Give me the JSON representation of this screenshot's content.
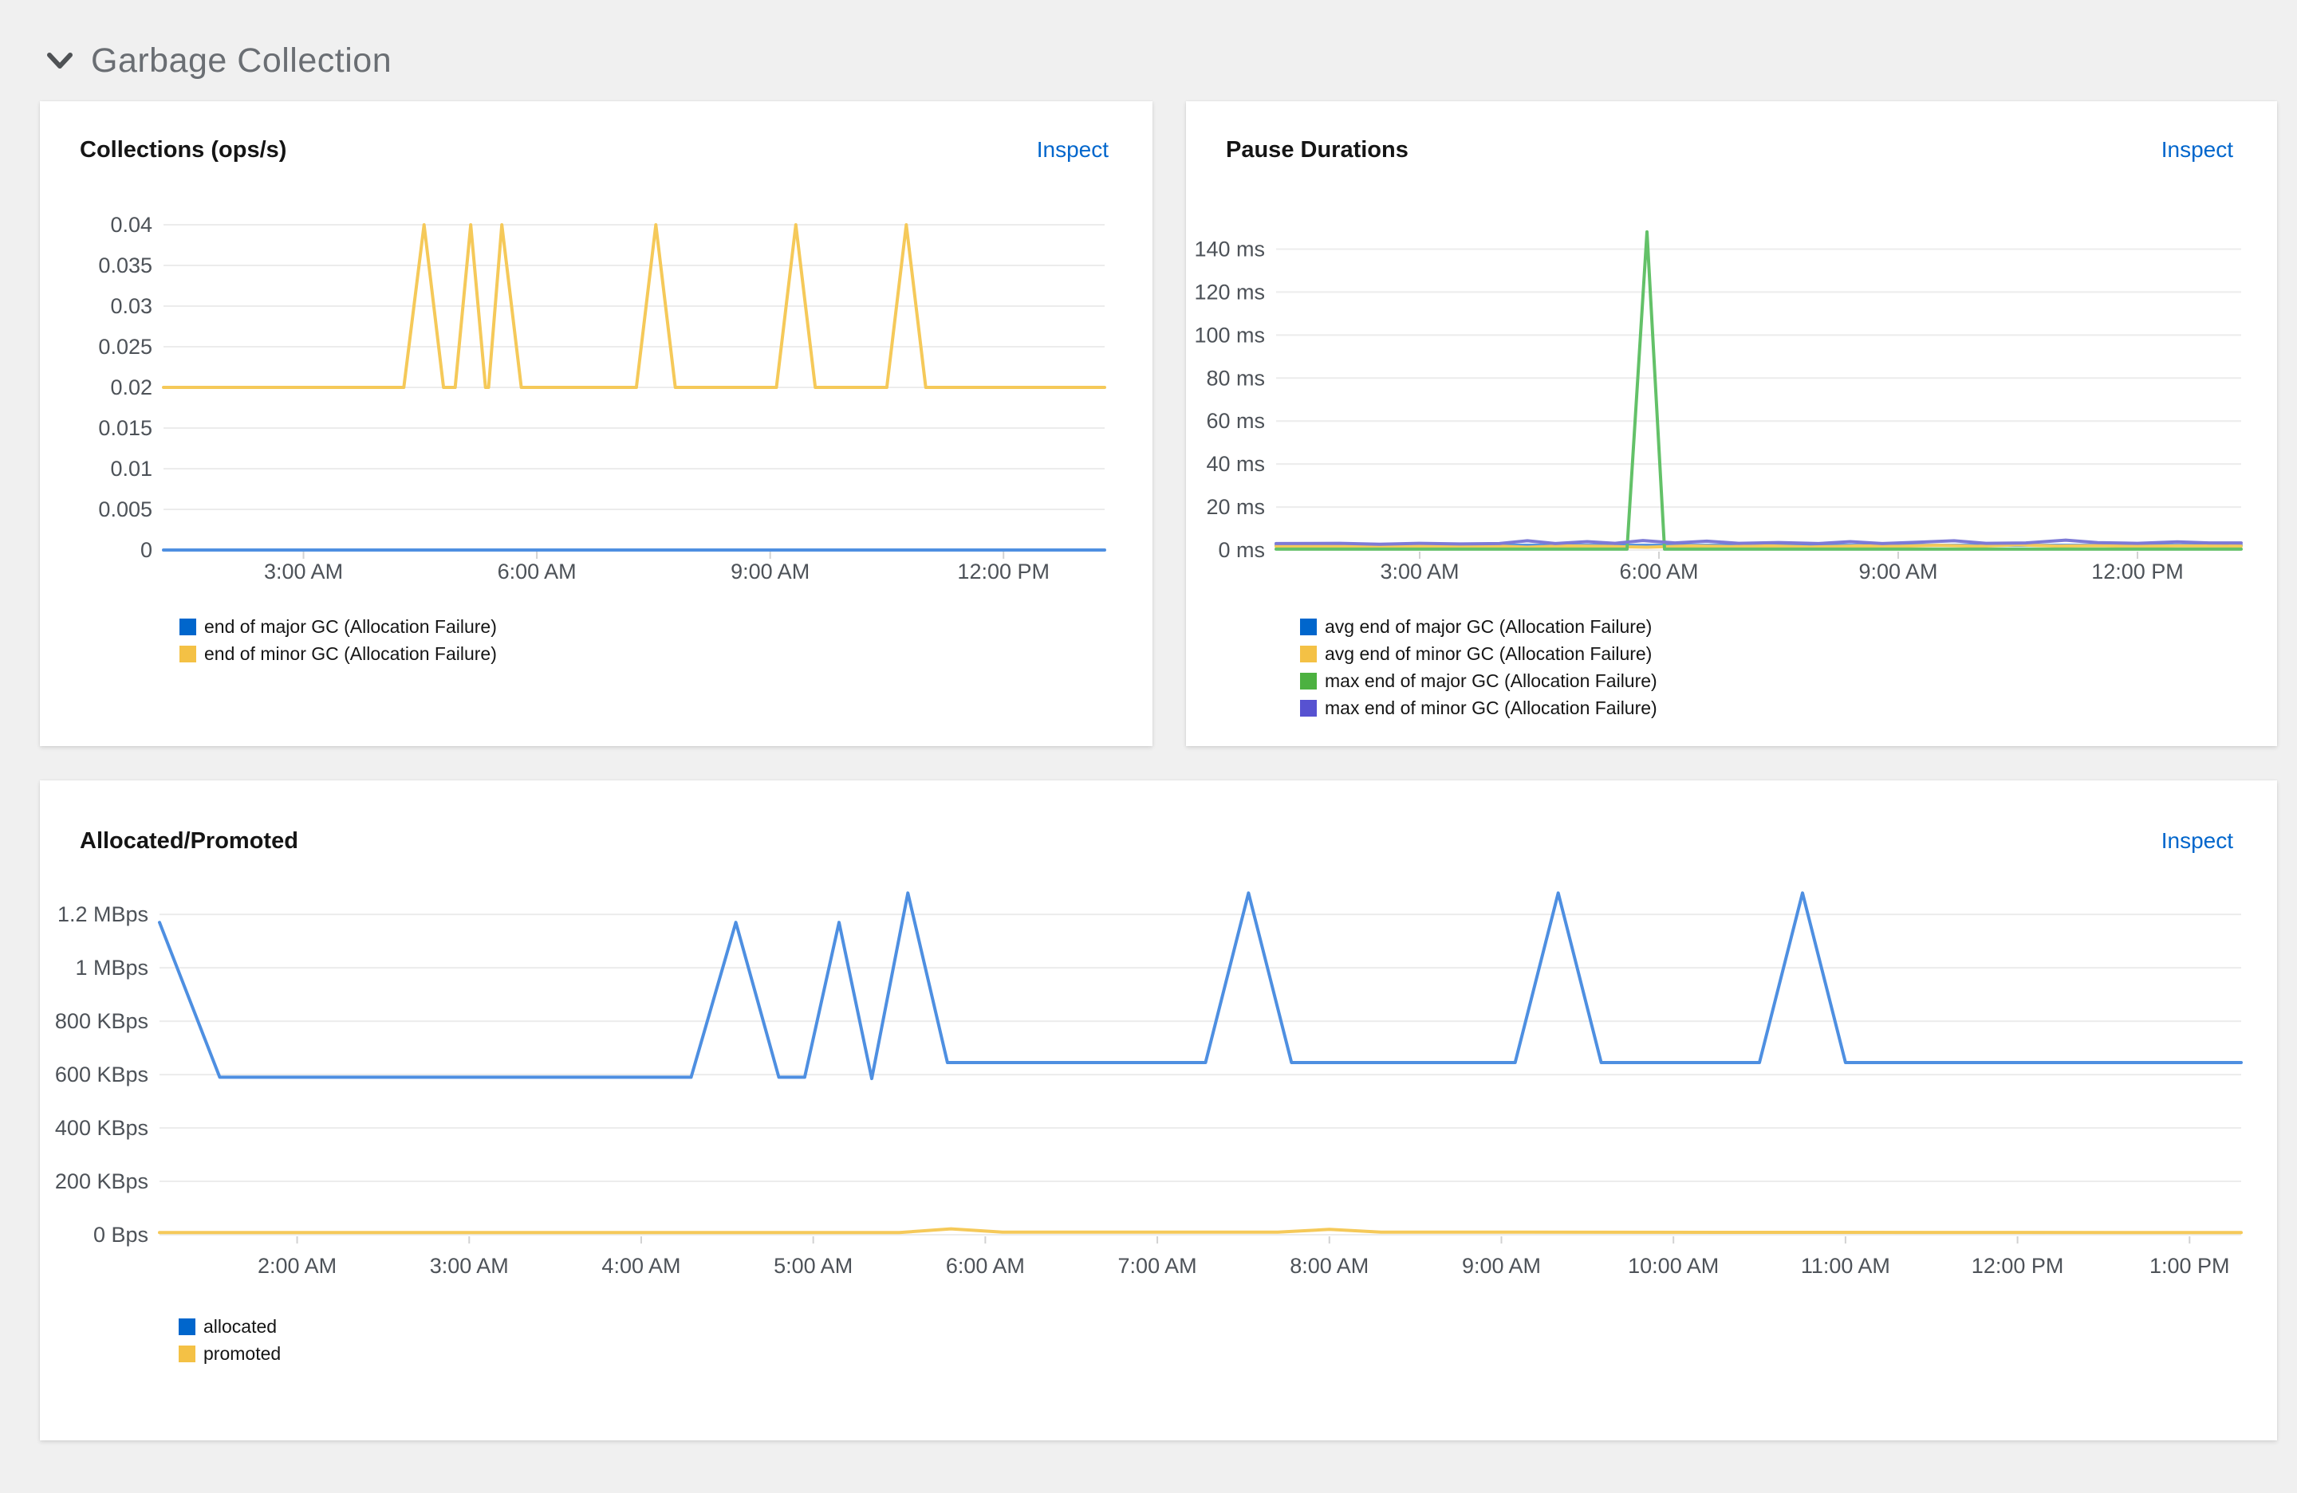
{
  "section": {
    "title": "Garbage Collection"
  },
  "chart_data": [
    {
      "id": "collections",
      "type": "line",
      "title": "Collections (ops/s)",
      "action": "Inspect",
      "x_range": [
        1.2,
        13.3
      ],
      "x_ticks": [
        {
          "t": 3,
          "label": "3:00 AM"
        },
        {
          "t": 6,
          "label": "6:00 AM"
        },
        {
          "t": 9,
          "label": "9:00 AM"
        },
        {
          "t": 12,
          "label": "12:00 PM"
        }
      ],
      "y_ticks": [
        {
          "v": 0.04,
          "label": "0.04"
        },
        {
          "v": 0.035,
          "label": "0.035"
        },
        {
          "v": 0.03,
          "label": "0.03"
        },
        {
          "v": 0.025,
          "label": "0.025"
        },
        {
          "v": 0.02,
          "label": "0.02"
        },
        {
          "v": 0.015,
          "label": "0.015"
        },
        {
          "v": 0.01,
          "label": "0.01"
        },
        {
          "v": 0.005,
          "label": "0.005"
        },
        {
          "v": 0,
          "label": "0"
        }
      ],
      "series": [
        {
          "name": "end of major GC (Allocation Failure)",
          "color": "#0066cc",
          "line_color": "#4e8fe1",
          "points": [
            [
              1.2,
              0
            ],
            [
              13.3,
              0
            ]
          ]
        },
        {
          "name": "end of minor GC (Allocation Failure)",
          "color": "#f4c145",
          "line_color": "#f5c959",
          "points": [
            [
              1.2,
              0.02
            ],
            [
              4.29,
              0.02
            ],
            [
              4.55,
              0.04
            ],
            [
              4.8,
              0.02
            ],
            [
              4.95,
              0.02
            ],
            [
              5.15,
              0.04
            ],
            [
              5.34,
              0.02
            ],
            [
              5.38,
              0.02
            ],
            [
              5.55,
              0.04
            ],
            [
              5.8,
              0.02
            ],
            [
              7.28,
              0.02
            ],
            [
              7.53,
              0.04
            ],
            [
              7.78,
              0.02
            ],
            [
              9.08,
              0.02
            ],
            [
              9.33,
              0.04
            ],
            [
              9.58,
              0.02
            ],
            [
              10.5,
              0.02
            ],
            [
              10.75,
              0.04
            ],
            [
              11.0,
              0.02
            ],
            [
              13.3,
              0.02
            ]
          ]
        }
      ]
    },
    {
      "id": "pause-durations",
      "type": "line",
      "title": "Pause Durations",
      "action": "Inspect",
      "x_range": [
        1.2,
        13.3
      ],
      "x_ticks": [
        {
          "t": 3,
          "label": "3:00 AM"
        },
        {
          "t": 6,
          "label": "6:00 AM"
        },
        {
          "t": 9,
          "label": "9:00 AM"
        },
        {
          "t": 12,
          "label": "12:00 PM"
        }
      ],
      "y_ticks": [
        {
          "v": 140,
          "label": "140 ms"
        },
        {
          "v": 120,
          "label": "120 ms"
        },
        {
          "v": 100,
          "label": "100 ms"
        },
        {
          "v": 80,
          "label": "80 ms"
        },
        {
          "v": 60,
          "label": "60 ms"
        },
        {
          "v": 40,
          "label": "40 ms"
        },
        {
          "v": 20,
          "label": "20 ms"
        },
        {
          "v": 0,
          "label": "0 ms"
        }
      ],
      "series": [
        {
          "name": "avg end of major GC (Allocation Failure)",
          "color": "#0066cc",
          "line_color": "#4e8fe1",
          "points": [
            [
              1.2,
              2.2
            ],
            [
              13.3,
              2.2
            ]
          ]
        },
        {
          "name": "avg end of minor GC (Allocation Failure)",
          "color": "#f4c145",
          "line_color": "#f5c959",
          "points": [
            [
              1.2,
              1.7
            ],
            [
              1.9,
              1.9
            ],
            [
              2.4,
              1.4
            ],
            [
              2.9,
              1.9
            ],
            [
              3.4,
              1.5
            ],
            [
              3.9,
              1.9
            ],
            [
              4.35,
              1.3
            ],
            [
              4.8,
              1.9
            ],
            [
              5.3,
              1.7
            ],
            [
              5.85,
              1.3
            ],
            [
              6.4,
              1.9
            ],
            [
              6.9,
              1.6
            ],
            [
              7.4,
              1.9
            ],
            [
              7.9,
              1.4
            ],
            [
              8.5,
              1.9
            ],
            [
              9.0,
              1.7
            ],
            [
              9.5,
              2.2
            ],
            [
              10.0,
              1.7
            ],
            [
              10.5,
              2.4
            ],
            [
              11.0,
              1.8
            ],
            [
              11.5,
              2.0
            ],
            [
              12.0,
              1.7
            ],
            [
              12.5,
              1.9
            ],
            [
              13.3,
              1.8
            ]
          ]
        },
        {
          "name": "max end of major GC (Allocation Failure)",
          "color": "#4cb140",
          "line_color": "#63c168",
          "points": [
            [
              1.2,
              0.4
            ],
            [
              5.6,
              0.4
            ],
            [
              5.85,
              148
            ],
            [
              6.07,
              0.4
            ],
            [
              13.3,
              0.4
            ]
          ]
        },
        {
          "name": "max end of minor GC (Allocation Failure)",
          "color": "#5752d1",
          "line_color": "#7d7ad6",
          "points": [
            [
              1.2,
              3.0
            ],
            [
              2.0,
              3.1
            ],
            [
              2.5,
              2.7
            ],
            [
              3.0,
              3.1
            ],
            [
              3.5,
              2.8
            ],
            [
              4.0,
              3.0
            ],
            [
              4.35,
              4.3
            ],
            [
              4.7,
              3.0
            ],
            [
              5.1,
              3.9
            ],
            [
              5.45,
              3.1
            ],
            [
              5.8,
              4.4
            ],
            [
              6.2,
              3.3
            ],
            [
              6.6,
              4.1
            ],
            [
              7.0,
              3.1
            ],
            [
              7.5,
              3.5
            ],
            [
              8.0,
              3.0
            ],
            [
              8.4,
              3.9
            ],
            [
              8.8,
              3.0
            ],
            [
              9.3,
              3.7
            ],
            [
              9.7,
              4.3
            ],
            [
              10.1,
              3.1
            ],
            [
              10.6,
              3.3
            ],
            [
              11.1,
              4.6
            ],
            [
              11.5,
              3.4
            ],
            [
              12.0,
              3.1
            ],
            [
              12.5,
              3.8
            ],
            [
              12.9,
              3.3
            ],
            [
              13.3,
              3.3
            ]
          ]
        }
      ]
    },
    {
      "id": "allocated-promoted",
      "type": "line",
      "title": "Allocated/Promoted",
      "action": "Inspect",
      "x_range": [
        1.2,
        13.3
      ],
      "x_ticks": [
        {
          "t": 2,
          "label": "2:00 AM"
        },
        {
          "t": 3,
          "label": "3:00 AM"
        },
        {
          "t": 4,
          "label": "4:00 AM"
        },
        {
          "t": 5,
          "label": "5:00 AM"
        },
        {
          "t": 6,
          "label": "6:00 AM"
        },
        {
          "t": 7,
          "label": "7:00 AM"
        },
        {
          "t": 8,
          "label": "8:00 AM"
        },
        {
          "t": 9,
          "label": "9:00 AM"
        },
        {
          "t": 10,
          "label": "10:00 AM"
        },
        {
          "t": 11,
          "label": "11:00 AM"
        },
        {
          "t": 12,
          "label": "12:00 PM"
        },
        {
          "t": 13,
          "label": "1:00 PM"
        }
      ],
      "y_ticks": [
        {
          "v": 1.2,
          "label": "1.2 MBps"
        },
        {
          "v": 1.0,
          "label": "1 MBps"
        },
        {
          "v": 0.8,
          "label": "800 KBps"
        },
        {
          "v": 0.6,
          "label": "600 KBps"
        },
        {
          "v": 0.4,
          "label": "400 KBps"
        },
        {
          "v": 0.2,
          "label": "200 KBps"
        },
        {
          "v": 0,
          "label": "0 Bps"
        }
      ],
      "series": [
        {
          "name": "allocated",
          "color": "#0066cc",
          "line_color": "#4e8fe1",
          "points": [
            [
              1.2,
              1.17
            ],
            [
              1.55,
              0.59
            ],
            [
              4.29,
              0.59
            ],
            [
              4.55,
              1.17
            ],
            [
              4.8,
              0.59
            ],
            [
              4.95,
              0.59
            ],
            [
              5.15,
              1.17
            ],
            [
              5.34,
              0.585
            ],
            [
              5.55,
              1.28
            ],
            [
              5.78,
              0.645
            ],
            [
              7.28,
              0.645
            ],
            [
              7.53,
              1.28
            ],
            [
              7.78,
              0.645
            ],
            [
              9.08,
              0.645
            ],
            [
              9.33,
              1.28
            ],
            [
              9.58,
              0.645
            ],
            [
              10.5,
              0.645
            ],
            [
              10.75,
              1.28
            ],
            [
              11.0,
              0.645
            ],
            [
              13.3,
              0.645
            ]
          ]
        },
        {
          "name": "promoted",
          "color": "#f4c145",
          "line_color": "#f5c959",
          "points": [
            [
              1.2,
              0.008
            ],
            [
              5.5,
              0.008
            ],
            [
              5.8,
              0.022
            ],
            [
              6.1,
              0.01
            ],
            [
              7.7,
              0.01
            ],
            [
              8.0,
              0.02
            ],
            [
              8.3,
              0.01
            ],
            [
              13.3,
              0.008
            ]
          ]
        }
      ]
    }
  ]
}
